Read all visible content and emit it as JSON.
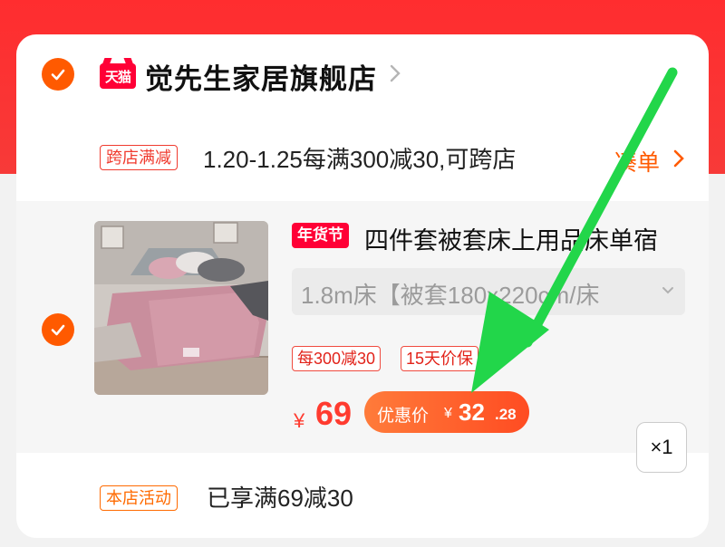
{
  "shop": {
    "name": "觉先生家居旗舰店",
    "logo_text": "天猫"
  },
  "cross_promo": {
    "tag": "跨店满减",
    "text": "1.20-1.25每满300减30,可跨店",
    "action": "凑单"
  },
  "item": {
    "badge": "年货节",
    "title": "四件套被套床上用品床单宿",
    "sku": "1.8m床【被套180x220cm/床",
    "tags": [
      "每300减30",
      "15天价保"
    ],
    "price_symbol": "¥",
    "price": "69",
    "discount_label": "优惠价",
    "discount_symbol": "¥",
    "discount_int": "32",
    "discount_dec": ".28",
    "quantity": "×1"
  },
  "store_promo": {
    "tag": "本店活动",
    "text": "已享满69减30"
  },
  "colors": {
    "accent_orange": "#ff5a00",
    "brand_red": "#ff0036",
    "arrow_green": "#22d64a"
  },
  "icons": {
    "check": "checkmark-icon",
    "chevron": "chevron-right-icon",
    "arrow": "green-arrow-annotation"
  }
}
